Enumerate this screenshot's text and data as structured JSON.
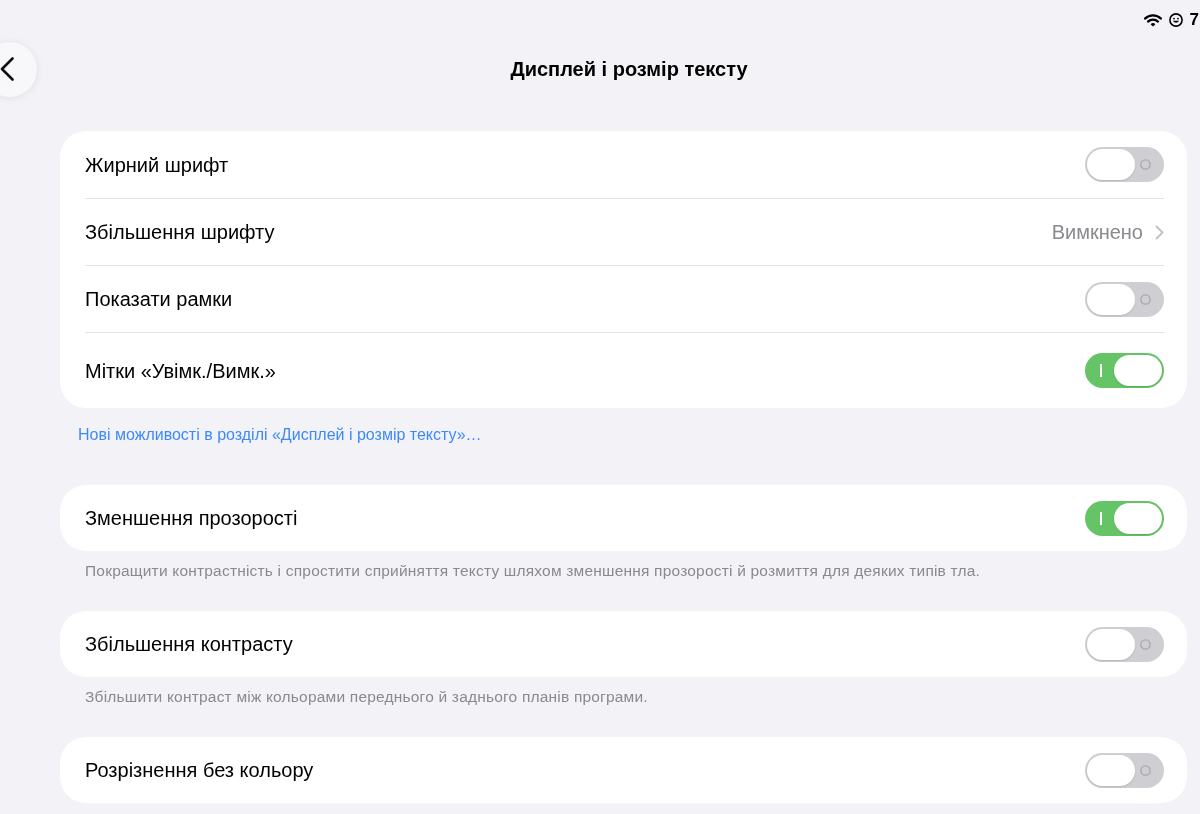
{
  "status_bar": {
    "text": "7"
  },
  "header": {
    "title": "Дисплей і розмір тексту"
  },
  "groups": [
    {
      "rows": [
        {
          "kind": "toggle",
          "label": "Жирний шрифт",
          "on": false
        },
        {
          "kind": "disclosure",
          "label": "Збільшення шрифту",
          "value": "Вимкнено"
        },
        {
          "kind": "toggle",
          "label": "Показати рамки",
          "on": false
        },
        {
          "kind": "toggle",
          "label": "Мітки «Увімк./Вимк.»",
          "on": true
        }
      ],
      "link": "Нові можливості в розділі «Дисплей і розмір тексту»…"
    },
    {
      "rows": [
        {
          "kind": "toggle",
          "label": "Зменшення прозорості",
          "on": true
        }
      ],
      "footer": "Покращити контрастність і спростити сприйняття тексту шляхом зменшення прозорості й розмиття для деяких типів тла."
    },
    {
      "rows": [
        {
          "kind": "toggle",
          "label": "Збільшення контрасту",
          "on": false
        }
      ],
      "footer": "Збільшити контраст між кольорами переднього й заднього планів програми."
    },
    {
      "rows": [
        {
          "kind": "toggle",
          "label": "Розрізнення без кольору",
          "on": false
        }
      ]
    }
  ]
}
